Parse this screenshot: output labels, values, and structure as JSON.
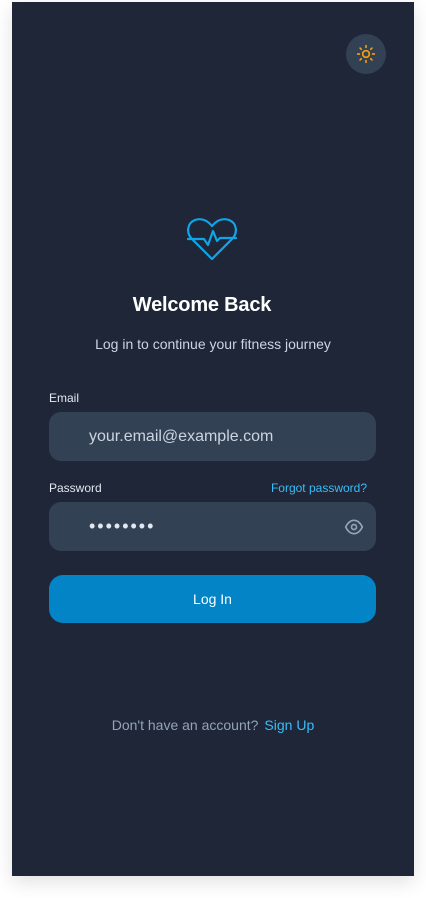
{
  "header": {
    "theme_toggle_icon": "sun-icon",
    "theme_toggle_color": "#f59e0b"
  },
  "brand": {
    "logo_icon": "heart-pulse-icon",
    "logo_color": "#0ea5e9"
  },
  "login": {
    "title": "Welcome Back",
    "subtitle": "Log in to continue your fitness journey",
    "email_label": "Email",
    "email_placeholder": "your.email@example.com",
    "password_label": "Password",
    "forgot_password": "Forgot password?",
    "password_value": "••••••••",
    "password_toggle_icon": "eye-icon",
    "submit_label": "Log In"
  },
  "footer": {
    "signup_prompt": "Don't have an account?",
    "signup_link": "Sign Up"
  },
  "colors": {
    "background": "#1e2638",
    "field_background": "#334155",
    "accent": "#0284c7",
    "link": "#38bdf8"
  }
}
